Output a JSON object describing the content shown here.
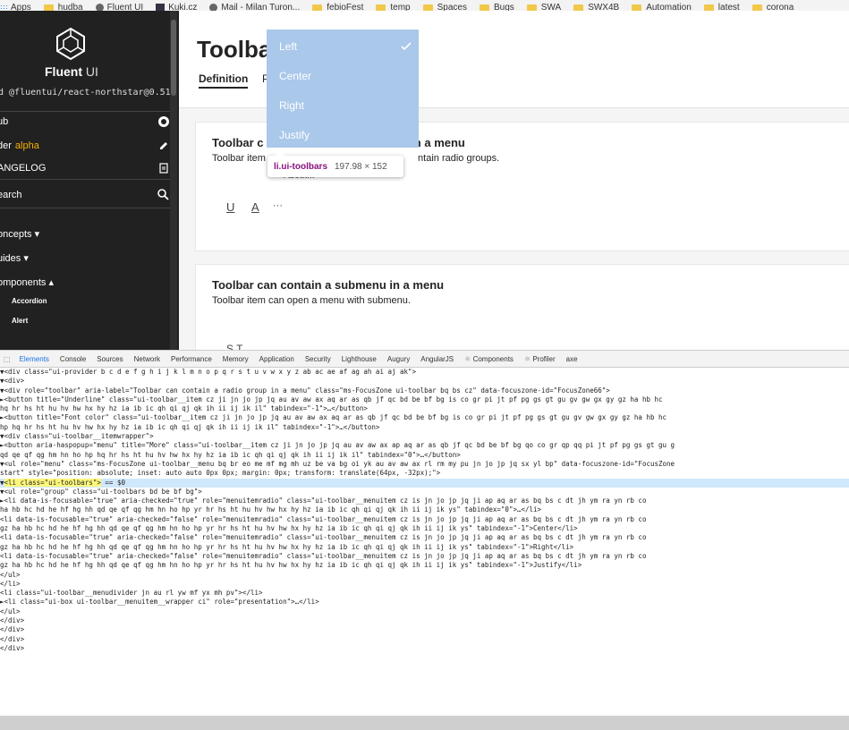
{
  "bookmarks": [
    {
      "label": "Apps",
      "icon": "apps-grid-icon"
    },
    {
      "label": "hudba",
      "icon": "folder-icon"
    },
    {
      "label": "Fluent UI",
      "icon": "fluent-logo-icon"
    },
    {
      "label": "Kuki.cz",
      "icon": "kuki-icon"
    },
    {
      "label": "Mail - Milan Turon...",
      "icon": "mail-icon"
    },
    {
      "label": "febioFest",
      "icon": "folder-icon"
    },
    {
      "label": "temp",
      "icon": "folder-icon"
    },
    {
      "label": "Spaces",
      "icon": "folder-icon"
    },
    {
      "label": "Bugs",
      "icon": "folder-icon"
    },
    {
      "label": "SWA",
      "icon": "folder-icon"
    },
    {
      "label": "SWX4B",
      "icon": "folder-icon"
    },
    {
      "label": "Automation",
      "icon": "folder-icon"
    },
    {
      "label": "latest",
      "icon": "folder-icon"
    },
    {
      "label": "corona",
      "icon": "folder-icon"
    }
  ],
  "sidebar": {
    "brand": "Fluent",
    "brand_suffix": "UI",
    "package": "d @fluentui/react-northstar@0.51",
    "github": "ub",
    "builder": "der",
    "builder_badge": "alpha",
    "changelog": "ANGELOG",
    "search": "earch",
    "concepts": "oncepts ▾",
    "guides": "uides ▾",
    "components": "omponents ▴",
    "sub_items": [
      "Accordion",
      "Alert"
    ]
  },
  "main": {
    "title": "Toolbar",
    "tab_definition": "Definition",
    "tab_partial": "P",
    "card1": {
      "title_left": "Toolbar c",
      "title_right": "n a menu",
      "desc_left": "Toolbar item",
      "desc_right": "ntain radio groups.",
      "underline_btn": "U",
      "font_btn": "A",
      "more_btn": "···"
    },
    "card2": {
      "title": "Toolbar can contain a submenu in a menu",
      "desc": "Toolbar item can open a menu with submenu.",
      "partial_buttons": "S  T  ..."
    },
    "about_partial": "About..."
  },
  "menu": {
    "items": [
      "Left",
      "Center",
      "Right",
      "Justify"
    ]
  },
  "tooltip": {
    "selector": "li.ui-toolbars",
    "dimensions": "197.98 × 152"
  },
  "devtools": {
    "tabs": [
      "Elements",
      "Console",
      "Sources",
      "Network",
      "Performance",
      "Memory",
      "Application",
      "Security",
      "Lighthouse",
      "Augury",
      "AngularJS",
      "Components",
      "Profiler",
      "axe"
    ],
    "code_lines": [
      "        ▼<div class=\"ui-provider b c d e f g h i j k l m n o p q r s t u v w x y z ab ac ae af ag ah ai aj ak\">",
      "          ▼<div>",
      "           ▼<div role=\"toolbar\" aria-label=\"Toolbar can contain a radio group in a menu\" class=\"ms-FocusZone ui-toolbar bq bs cz\" data-focuszone-id=\"FocusZone66\">",
      "            ►<button title=\"Underline\" class=\"ui-toolbar__item cz ji jn jo jp jq au av aw ax aq ar as qb jf qc bd be bf bg is co gr pi jt pf pg gs gt gu gv gw gx gy gz ha hb hc",
      "            hq hr hs ht hu hv hw hx hy hz ia ib ic qh qi qj qk ih ii ij ik il\" tabindex=\"-1\">…</button>",
      "            ►<button title=\"Font color\" class=\"ui-toolbar__item cz ji jn jo jp jq au av aw ax aq ar as qb jf qc bd be bf bg is co gr pi jt pf pg gs gt gu gv gw gx gy gz ha hb hc",
      "            hp hq hr hs ht hu hv hw hx hy hz ia ib ic qh qi qj qk ih ii ij ik il\" tabindex=\"-1\">…</button>",
      "            ▼<div class=\"ui-toolbar__itemwrapper\">",
      "              ►<button aria-haspopup=\"menu\" title=\"More\" class=\"ui-toolbar__item cz ji jn jo jp jq au av aw ax ap aq ar as qb jf qc bd be bf bg qo co gr qp qq pi jt pf pg gs gt gu g",
      "              qd qe qf qg hm hn ho hp hq hr hs ht hu hv hw hx hy hz ia ib ic qh qi qj qk ih ii ij ik il\" tabindex=\"0\">…</button>",
      "              ▼<ul role=\"menu\" class=\"ms-FocusZone ui-toolbar__menu bq br eo me mf mg mh uz be va bg oi yk au av aw ax rl rm my pu jn jo jp jq sx yl bp\" data-focuszone-id=\"FocusZone",
      "              start\" style=\"position: absolute; inset: auto auto 0px 0px; margin: 0px; transform: translate(64px, -32px);\">",
      "                ▼<li class=\"ui-toolbars\"> == $0",
      "                  ▼<ul role=\"group\" class=\"ui-toolbars bd be bf bg\">",
      "                    ►<li data-is-focusable=\"true\" aria-checked=\"true\" role=\"menuitemradio\" class=\"ui-toolbar__menuitem cz is jn jo jp jq ji ap aq ar as bq bs c dt jh ym ra yn rb co",
      "                    ha hb hc hd he hf hg hh qd qe qf qg hm hn ho hp yr hr hs ht hu hv hw hx hy hz ia ib ic qh qi qj qk ih ii ij ik ys\" tabindex=\"0\">…</li>",
      "                      <li data-is-focusable=\"true\" aria-checked=\"false\" role=\"menuitemradio\" class=\"ui-toolbar__menuitem cz is jn jo jp jq ji ap aq ar as bq bs c dt jh ym ra yn rb co",
      "                      gz ha hb hc hd he hf hg hh qd qe qf qg hm hn ho hp yr hr hs ht hu hv hw hx hy hz ia ib ic qh qi qj qk ih ii ij ik ys\" tabindex=\"-1\">Center</li>",
      "                      <li data-is-focusable=\"true\" aria-checked=\"false\" role=\"menuitemradio\" class=\"ui-toolbar__menuitem cz is jn jo jp jq ji ap aq ar as bq bs c dt jh ym ra yn rb co",
      "                      gz ha hb hc hd he hf hg hh qd qe qf qg hm hn ho hp yr hr hs ht hu hv hw hx hy hz ia ib ic qh qi qj qk ih ii ij ik ys\" tabindex=\"-1\">Right</li>",
      "                      <li data-is-focusable=\"true\" aria-checked=\"false\" role=\"menuitemradio\" class=\"ui-toolbar__menuitem cz is jn jo jp jq ji ap aq ar as bq bs c dt jh ym ra yn rb co",
      "                      gz ha hb hc hd he hf hg hh qd qe qf qg hm hn ho hp yr hr hs ht hu hv hw hx hy hz ia ib ic qh qi qj qk ih ii ij ik ys\" tabindex=\"-1\">Justify</li>",
      "                    </ul>",
      "                  </li>",
      "                  <li class=\"ui-toolbar__menudivider jn au rl yw mf yx mh pv\"></li>",
      "                ►<li class=\"ui-box ui-toolbar__menuitem__wrapper ci\" role=\"presentation\">…</li>",
      "                </ul>",
      "              </div>",
      "            </div>",
      "          </div>",
      "        </div>"
    ]
  },
  "colors": {
    "sidebar_bg": "#212121",
    "menu_overlay": "#a9c8ea",
    "alpha_badge": "#f6b100",
    "selection_highlight": "#fdf77b",
    "selected_row": "#cfe8fc"
  }
}
